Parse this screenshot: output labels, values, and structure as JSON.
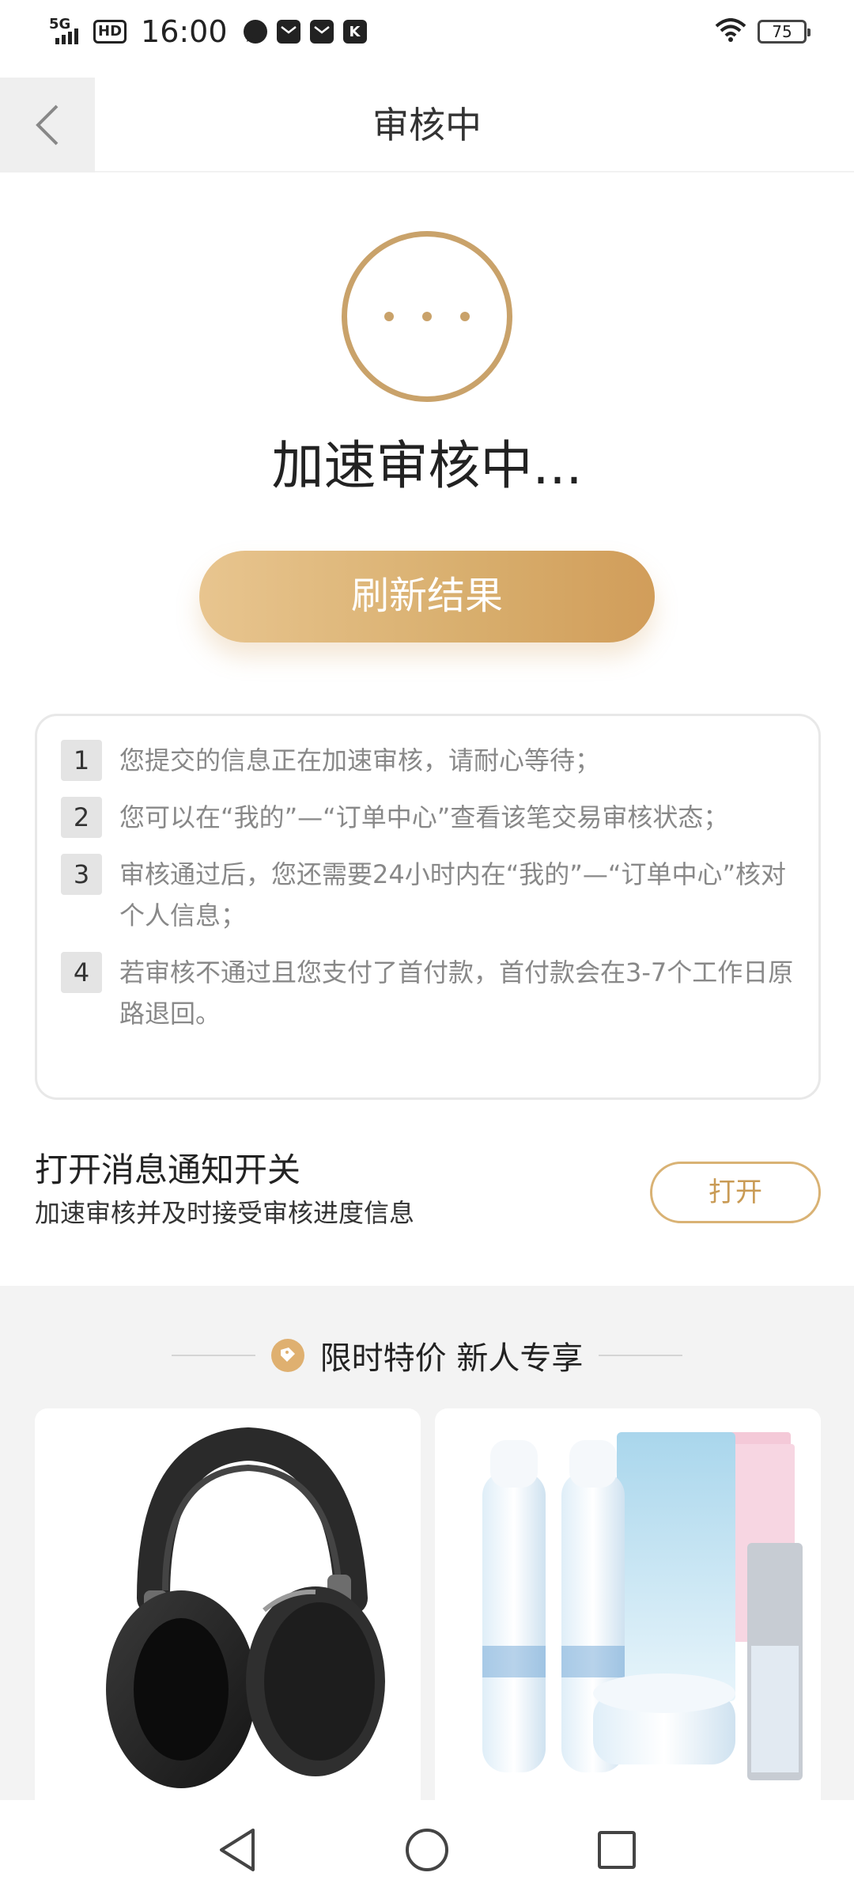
{
  "status_bar": {
    "network": "5G",
    "hd": "HD",
    "time": "16:00",
    "battery": "75",
    "notification_icons": [
      "chat-bubble-icon",
      "mail-icon",
      "mail-icon",
      "k-app-icon"
    ]
  },
  "header": {
    "title": "审核中"
  },
  "status": {
    "title": "加速审核中..."
  },
  "refresh_button": "刷新结果",
  "info": {
    "items": [
      {
        "num": "1",
        "text": "您提交的信息正在加速审核，请耐心等待；"
      },
      {
        "num": "2",
        "text": "您可以在“我的”—“订单中心”查看该笔交易审核状态；"
      },
      {
        "num": "3",
        "text": "审核通过后，您还需要24小时内在“我的”—“订单中心”核对个人信息；"
      },
      {
        "num": "4",
        "text": "若审核不通过且您支付了首付款，首付款会在3-7个工作日原路退回。"
      }
    ]
  },
  "notify": {
    "title": "打开消息通知开关",
    "subtitle": "加速审核并及时接受审核进度信息",
    "button": "打开"
  },
  "promo": {
    "title": "限时特价 新人专享",
    "products": [
      {
        "image": "headphones-image"
      },
      {
        "image": "skincare-set-image"
      }
    ]
  },
  "nav": {
    "back": "back-triangle-icon",
    "home": "home-circle-icon",
    "recent": "recent-square-icon"
  },
  "colors": {
    "accent": "#c9a26a",
    "button_gradient_start": "#e8c58f",
    "button_gradient_end": "#d19d5a"
  }
}
